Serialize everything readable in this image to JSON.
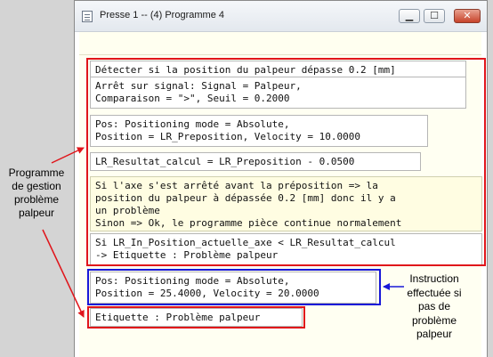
{
  "window": {
    "title": "Presse 1 -- (4) Programme 4",
    "controls": {
      "minimize": "▁",
      "maximize": "☐",
      "close": "✕"
    }
  },
  "program": {
    "block1_title": "Détecter si la position du palpeur dépasse 0.2 [mm]",
    "block1_detail": "Arrêt sur signal: Signal = Palpeur,\nComparaison = \">\", Seuil = 0.2000",
    "pos1": "Pos: Positioning mode = Absolute,\nPosition = LR_Preposition, Velocity = 10.0000",
    "calc": "LR_Resultat_calcul = LR_Preposition - 0.0500",
    "comment": "Si l'axe s'est arrêté avant la préposition => la\nposition du palpeur à dépassée 0.2 [mm] donc il y a\nun problème\nSinon => Ok, le programme pièce continue normalement",
    "condition": "Si LR_In_Position_actuelle_axe < LR_Resultat_calcul\n-> Etiquette : Problème palpeur",
    "pos2": "Pos: Positioning mode = Absolute,\nPosition = 25.4000, Velocity = 20.0000",
    "label": "Etiquette : Problème palpeur"
  },
  "annotations": {
    "left": "Programme\nde gestion\nproblème\npalpeur",
    "right": "Instruction\neffectuée si\npas de\nproblème\npalpeur"
  },
  "colors": {
    "highlight_red": "#e0151b",
    "highlight_blue": "#1818d8",
    "arrow_red": "#e0151b",
    "arrow_blue": "#1818d8"
  }
}
